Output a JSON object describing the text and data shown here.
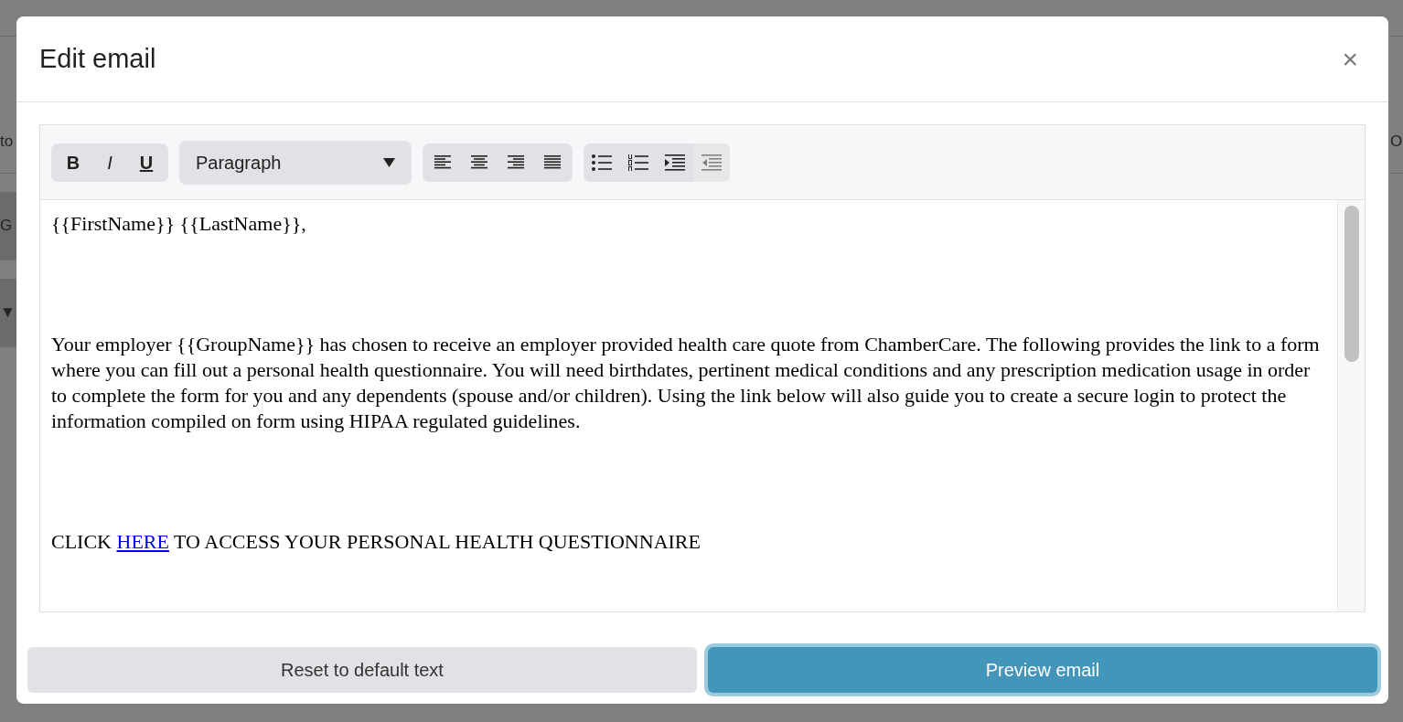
{
  "background": {
    "left": [
      {
        "text": "to",
        "kind": "plain"
      },
      {
        "text": "G",
        "kind": "band"
      },
      {
        "text": "▼",
        "kind": "band"
      }
    ],
    "right": [
      {
        "text": "O",
        "kind": "plain"
      }
    ]
  },
  "dialog": {
    "title": "Edit email",
    "close": "×"
  },
  "toolbar": {
    "style_buttons": [
      {
        "label": "B",
        "kind": "bold"
      },
      {
        "label": "I",
        "kind": "italic"
      },
      {
        "label": "U",
        "kind": "underline"
      }
    ],
    "format": {
      "value": "Paragraph"
    },
    "align_buttons": [
      {
        "kind": "left"
      },
      {
        "kind": "center"
      },
      {
        "kind": "right"
      },
      {
        "kind": "justify"
      }
    ],
    "list_buttons": [
      {
        "kind": "bullets",
        "disabled": false
      },
      {
        "kind": "numbers",
        "disabled": false
      },
      {
        "kind": "indent",
        "disabled": false
      },
      {
        "kind": "outdent",
        "disabled": true
      }
    ]
  },
  "editor": {
    "paragraphs": [
      [
        {
          "kind": "text",
          "text": "{{FirstName}} {{LastName}},"
        }
      ],
      [
        {
          "kind": "text",
          "text": "Your employer {{GroupName}} has chosen to receive an employer provided health care quote from ChamberCare. The following provides the link to a form where you can fill out a personal health questionnaire. You will need birthdates, pertinent medical conditions and any prescription medication usage in order to complete the form for you and any dependents (spouse and/or children). Using the link below will also guide you to create a secure login to protect the information compiled on form using HIPAA regulated guidelines."
        }
      ],
      [
        {
          "kind": "text",
          "text": "CLICK "
        },
        {
          "kind": "link",
          "text": "HERE"
        },
        {
          "kind": "text",
          "text": " TO ACCESS YOUR PERSONAL HEALTH QUESTIONNAIRE"
        }
      ]
    ]
  },
  "buttons": [
    {
      "label": "Reset to default text",
      "kind": "secondary"
    },
    {
      "label": "Preview email",
      "kind": "primary"
    }
  ]
}
